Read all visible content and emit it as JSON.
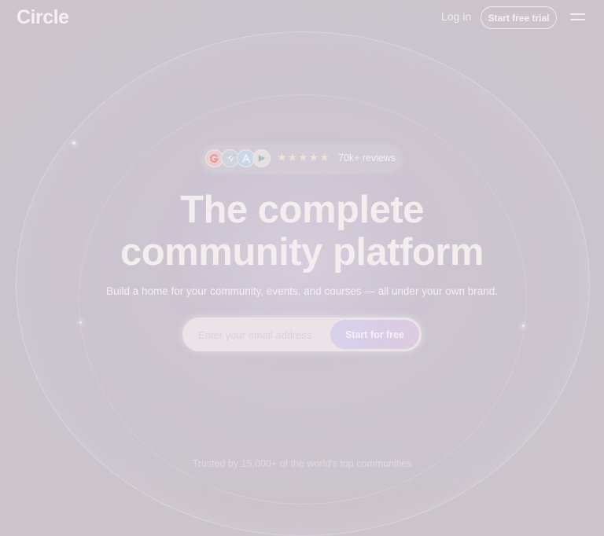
{
  "header": {
    "logo": "Circle",
    "login_label": "Log in",
    "trial_label": "Start free trial",
    "menu_icon": "hamburger-menu-icon"
  },
  "reviews": {
    "platform_icons": [
      "g2-icon",
      "capterra-icon",
      "app-store-icon",
      "google-play-icon"
    ],
    "stars": "★★★★★",
    "rating_stars": 5,
    "count_label": "70k+ reviews"
  },
  "hero": {
    "headline_line1": "The complete",
    "headline_line2": "community platform",
    "subheadline": "Build a home for your community, events, and courses — all under your own brand."
  },
  "signup": {
    "email_placeholder": "Enter your email address",
    "email_value": "",
    "submit_label": "Start for free"
  },
  "footer": {
    "trusted_text": "Trusted by 15,000+ of the world's top communities"
  },
  "colors": {
    "background": "#cbc5ca",
    "text": "#f2eeef",
    "button_gradient_start": "#d7d2ea",
    "button_gradient_end": "#dccbe0"
  }
}
